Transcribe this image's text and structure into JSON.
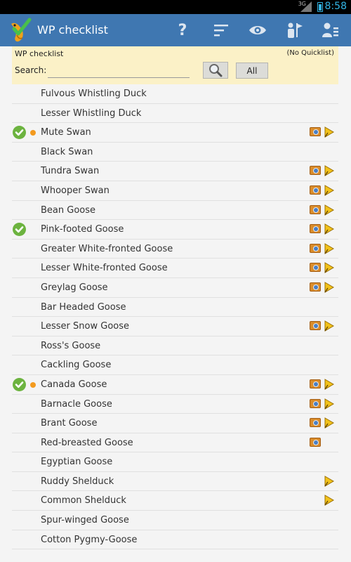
{
  "status_bar": {
    "signal": "3G",
    "time": "8:58"
  },
  "app": {
    "title": "WP checklist"
  },
  "action_bar": {
    "help_label": "?",
    "icons": [
      "help-icon",
      "sort-icon",
      "eye-icon",
      "observer-icon",
      "list-icon"
    ]
  },
  "header": {
    "title": "WP checklist",
    "quicklist": "(No Quicklist)",
    "search_label": "Search:",
    "search_value": "",
    "all_label": "All"
  },
  "species": [
    {
      "name": "Fulvous Whistling Duck",
      "checked": false,
      "dot": false,
      "photo": false,
      "sound": false
    },
    {
      "name": "Lesser Whistling Duck",
      "checked": false,
      "dot": false,
      "photo": false,
      "sound": false
    },
    {
      "name": "Mute Swan",
      "checked": true,
      "dot": true,
      "photo": true,
      "sound": true
    },
    {
      "name": "Black Swan",
      "checked": false,
      "dot": false,
      "photo": false,
      "sound": false
    },
    {
      "name": "Tundra Swan",
      "checked": false,
      "dot": false,
      "photo": true,
      "sound": true
    },
    {
      "name": "Whooper Swan",
      "checked": false,
      "dot": false,
      "photo": true,
      "sound": true
    },
    {
      "name": "Bean Goose",
      "checked": false,
      "dot": false,
      "photo": true,
      "sound": true
    },
    {
      "name": "Pink-footed Goose",
      "checked": true,
      "dot": false,
      "photo": true,
      "sound": true
    },
    {
      "name": "Greater White-fronted Goose",
      "checked": false,
      "dot": false,
      "photo": true,
      "sound": true
    },
    {
      "name": "Lesser White-fronted Goose",
      "checked": false,
      "dot": false,
      "photo": true,
      "sound": true
    },
    {
      "name": "Greylag Goose",
      "checked": false,
      "dot": false,
      "photo": true,
      "sound": true
    },
    {
      "name": "Bar Headed Goose",
      "checked": false,
      "dot": false,
      "photo": false,
      "sound": false
    },
    {
      "name": "Lesser Snow Goose",
      "checked": false,
      "dot": false,
      "photo": true,
      "sound": true
    },
    {
      "name": "Ross's Goose",
      "checked": false,
      "dot": false,
      "photo": false,
      "sound": false
    },
    {
      "name": "Cackling Goose",
      "checked": false,
      "dot": false,
      "photo": false,
      "sound": false
    },
    {
      "name": "Canada Goose",
      "checked": true,
      "dot": true,
      "photo": true,
      "sound": true
    },
    {
      "name": "Barnacle Goose",
      "checked": false,
      "dot": false,
      "photo": true,
      "sound": true
    },
    {
      "name": "Brant Goose",
      "checked": false,
      "dot": false,
      "photo": true,
      "sound": true
    },
    {
      "name": "Red-breasted Goose",
      "checked": false,
      "dot": false,
      "photo": true,
      "sound": false
    },
    {
      "name": "Egyptian Goose",
      "checked": false,
      "dot": false,
      "photo": false,
      "sound": false
    },
    {
      "name": "Ruddy Shelduck",
      "checked": false,
      "dot": false,
      "photo": false,
      "sound": true
    },
    {
      "name": "Common Shelduck",
      "checked": false,
      "dot": false,
      "photo": false,
      "sound": true
    },
    {
      "name": "Spur-winged Goose",
      "checked": false,
      "dot": false,
      "photo": false,
      "sound": false
    },
    {
      "name": "Cotton Pygmy-Goose",
      "checked": false,
      "dot": false,
      "photo": false,
      "sound": false
    }
  ],
  "colors": {
    "action_bar": "#3f77b1",
    "header_panel": "#fbf1c7",
    "check": "#6cb33f",
    "dot": "#f39a1e",
    "status_accent": "#33b5e5"
  }
}
